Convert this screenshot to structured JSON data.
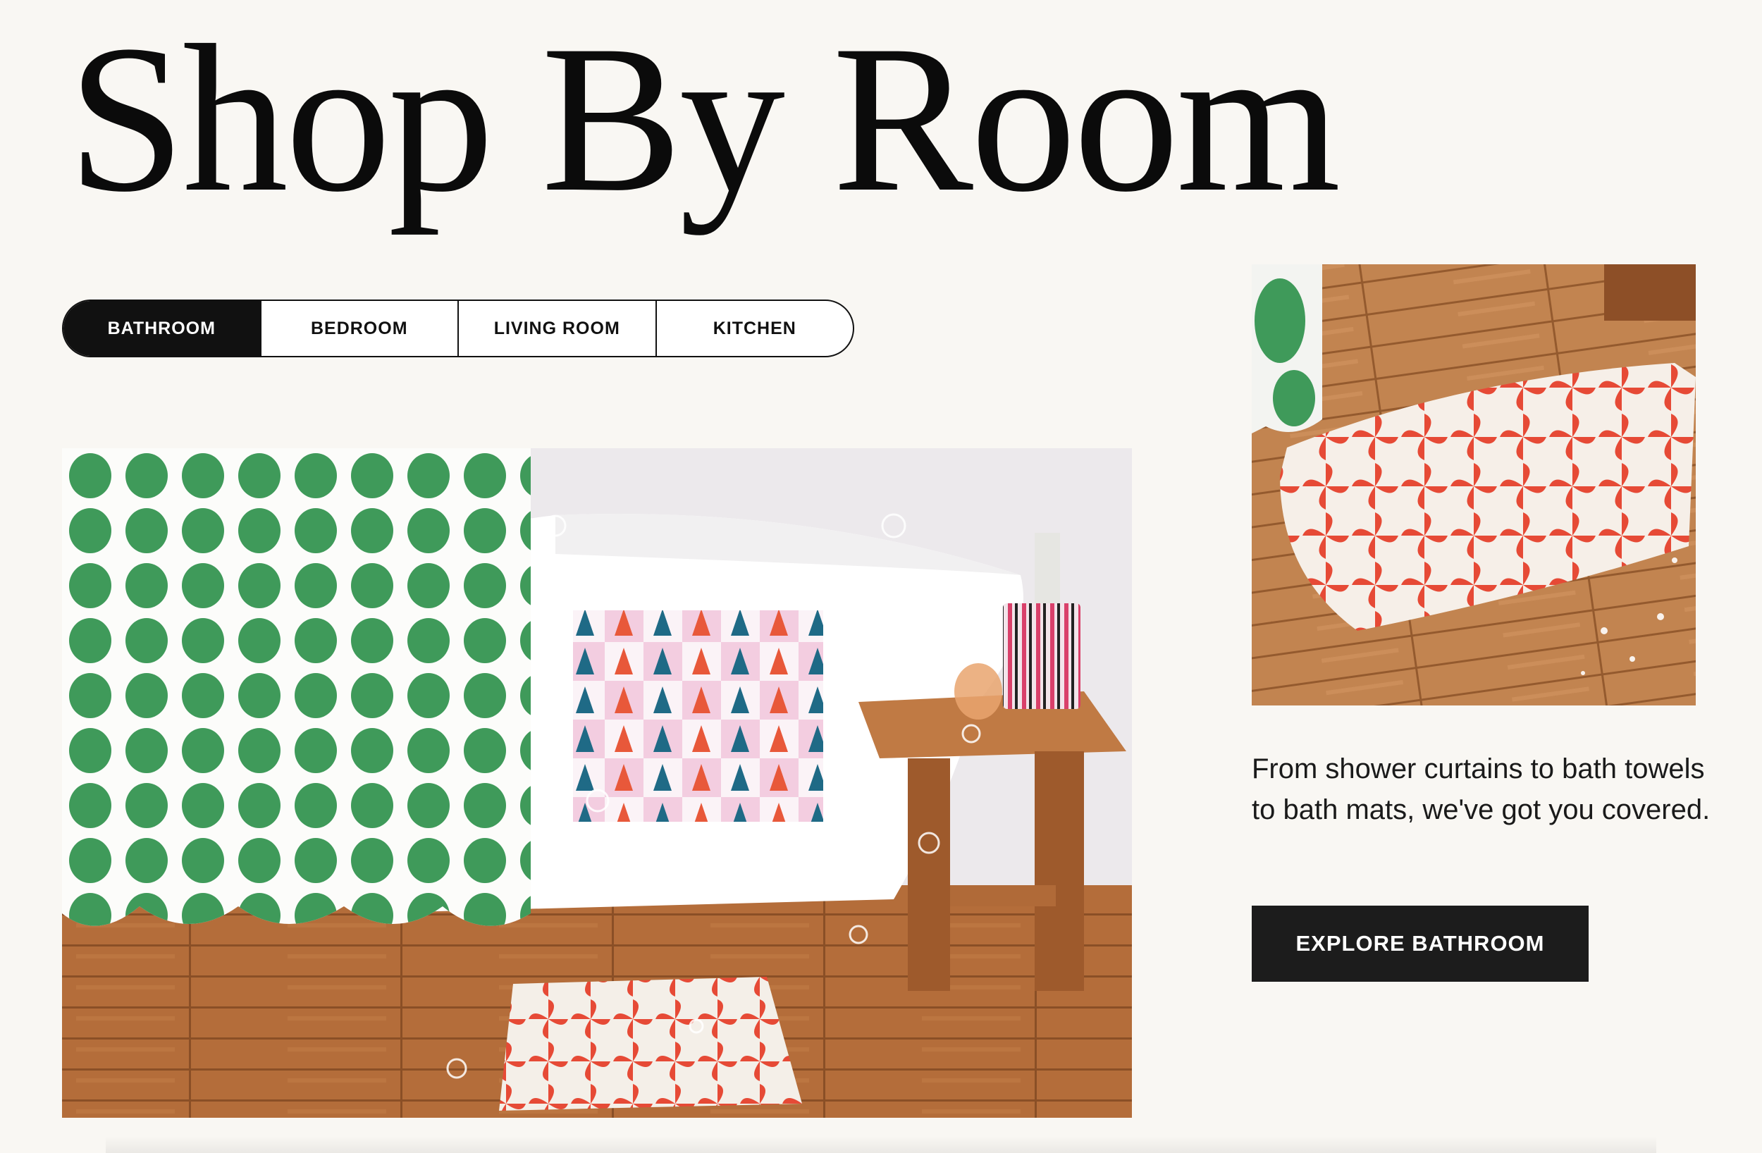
{
  "header": {
    "title": "Shop By Room"
  },
  "tabs": [
    {
      "label": "BATHROOM",
      "active": true
    },
    {
      "label": "BEDROOM",
      "active": false
    },
    {
      "label": "LIVING ROOM",
      "active": false
    },
    {
      "label": "KITCHEN",
      "active": false
    }
  ],
  "feature": {
    "description": "From shower curtains to bath towels to bath mats, we've got you covered.",
    "cta_label": "EXPLORE BATHROOM"
  },
  "colors": {
    "accent": "#111111",
    "curtain_dots": "#3f9a5a",
    "mat_red": "#e64a36",
    "wood": "#b06a38"
  }
}
